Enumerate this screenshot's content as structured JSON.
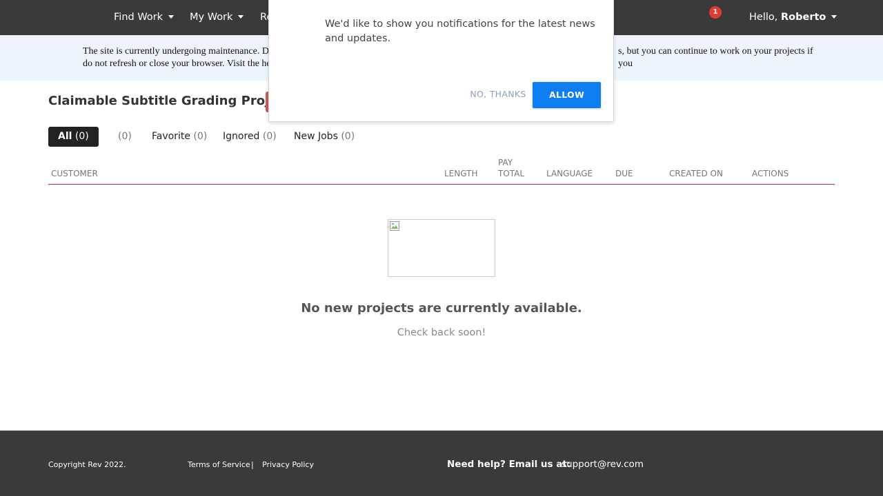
{
  "nav": {
    "find_work": "Find Work",
    "my_work": "My Work",
    "re_truncated": "Re",
    "notification_count": "1",
    "hello": "Hello, ",
    "user_name": "Roberto"
  },
  "banner": {
    "line1_left": "The site is currently undergoing maintenance. D",
    "line1_right": "s, but you can continue to work on your projects if you",
    "line2_left": "do not refresh or close your browser. Visit the he"
  },
  "page": {
    "title": "Claimable Subtitle Grading Projects"
  },
  "tabs": [
    {
      "label": "All",
      "count": "(0)"
    },
    {
      "label": "",
      "count": "(0)"
    },
    {
      "label": "Favorite",
      "count": "(0)"
    },
    {
      "label": "Ignored",
      "count": "(0)"
    },
    {
      "label": "New Jobs",
      "count": "(0)"
    }
  ],
  "table": {
    "headers": {
      "customer": "CUSTOMER",
      "length": "LENGTH",
      "pay_line1": "PAY",
      "pay_line2": "TOTAL",
      "language": "LANGUAGE",
      "due": "DUE",
      "created_on": "CREATED ON",
      "actions": "ACTIONS"
    }
  },
  "empty": {
    "title": "No new projects are currently available.",
    "subtitle": "Check back soon!"
  },
  "footer": {
    "copyright": "Copyright Rev 2022.",
    "terms": "Terms of Service",
    "separator": "|",
    "privacy": "Privacy Policy",
    "help": "Need help? Email us at:",
    "email": "support@rev.com"
  },
  "popup": {
    "message": "We'd like to show you notifications for the latest news and updates.",
    "no_thanks": "NO, THANKS",
    "allow": "ALLOW"
  },
  "colors": {
    "nav_bg": "#3a3a3a",
    "banner_bg": "#eef4fb",
    "accent_line": "#b0303b",
    "allow_button": "#0e7ef2",
    "badge": "#e53935"
  }
}
